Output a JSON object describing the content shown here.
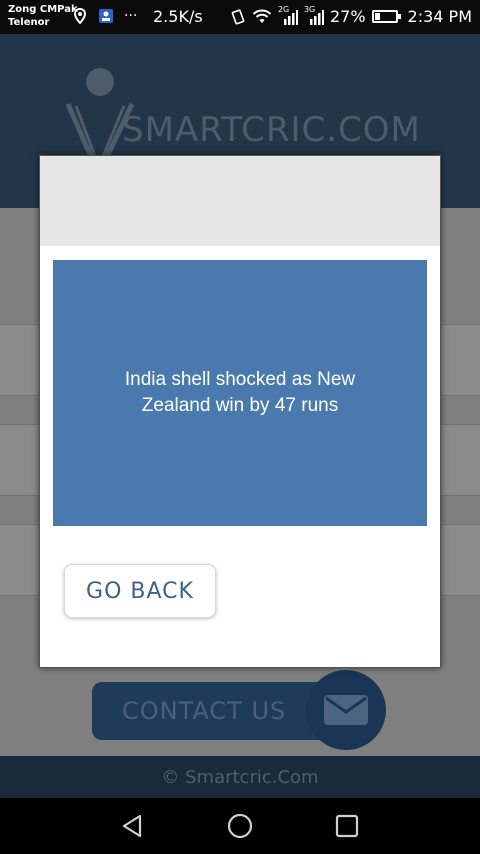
{
  "status_bar": {
    "carrier_1": "Zong CMPak",
    "carrier_2": "Telenor",
    "overflow": "···",
    "speed": "2.5K/s",
    "network_1": "2G",
    "network_2": "3G",
    "battery_percent": "27%",
    "battery_level": 0.27,
    "time": "2:34 PM",
    "icons": [
      "location-icon",
      "image-notification-icon",
      "vibrate-icon",
      "wifi-icon",
      "signal-icon",
      "battery-icon"
    ]
  },
  "app": {
    "logo_text": "SMARTCRIC.COM",
    "contact_label": "CONTACT US",
    "footer_text": "© Smartcric.Com"
  },
  "modal": {
    "headline": "India shell shocked as New Zealand win by 47 runs",
    "back_label": "GO BACK",
    "card_color": "#4a7aad"
  },
  "nav": {
    "buttons": [
      "back-icon",
      "home-icon",
      "recents-icon"
    ]
  }
}
